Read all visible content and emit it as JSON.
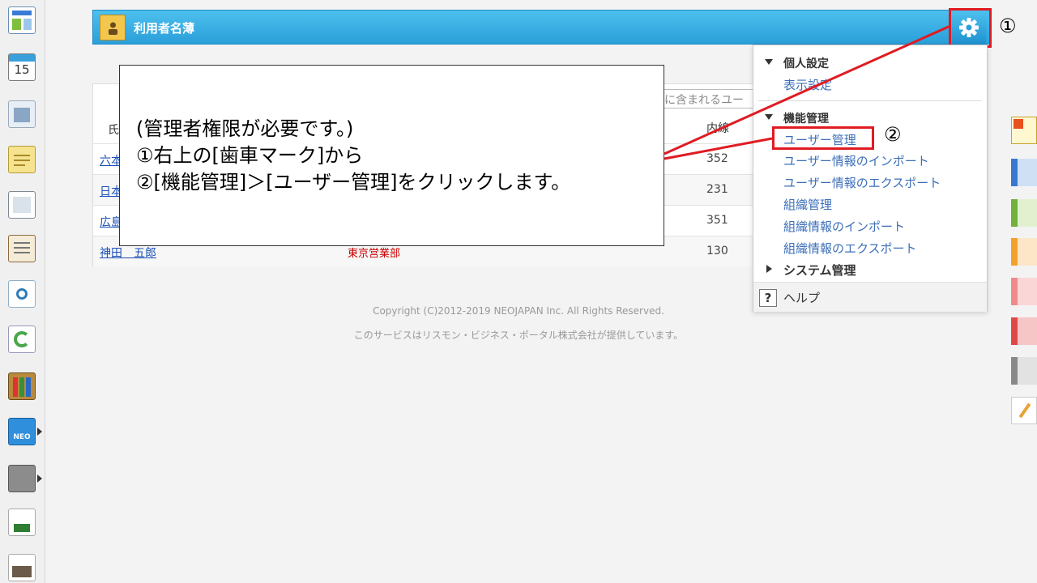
{
  "header": {
    "title": "利用者名薄"
  },
  "markers": {
    "one": "①",
    "two": "②"
  },
  "table": {
    "search_placeholder": "に含まれるユー",
    "col_ext_label": "内線",
    "col_name_stub": "氏",
    "rows": [
      {
        "name": "六本",
        "dept": "",
        "ext": "352"
      },
      {
        "name": "日本",
        "dept": "",
        "ext": "231"
      },
      {
        "name": "広島",
        "dept": "",
        "ext": "351"
      },
      {
        "name": "神田　五郎",
        "dept": "東京営業部",
        "ext": "130"
      }
    ]
  },
  "footer": {
    "copyright": "Copyright (C)2012-2019 NEOJAPAN Inc. All Rights Reserved.",
    "provider": "このサービスはリスモン・ビジネス・ポータル株式会社が提供しています。"
  },
  "note": {
    "line1": "(管理者権限が必要です。)",
    "line2": "①右上の[歯車マーク]から",
    "line3": "②[機能管理]＞[ユーザー管理]をクリックします。"
  },
  "menu": {
    "personal_section": "個人設定",
    "display_settings": "表示設定",
    "function_section": "機能管理",
    "user_management": "ユーザー管理",
    "user_import": "ユーザー情報のインポート",
    "user_export": "ユーザー情報のエクスポート",
    "org_management": "組織管理",
    "org_import": "組織情報のインポート",
    "org_export": "組織情報のエクスポート",
    "system_section": "システム管理",
    "help": "ヘルプ",
    "help_glyph": "?"
  },
  "colors": {
    "header_blue": "#2a9fd9",
    "highlight_red": "#e01b22",
    "link_blue": "#3c6fb8"
  },
  "sidebar_icons": [
    "portal-icon",
    "calendar-icon",
    "facility-icon",
    "memo-icon",
    "bulletin-icon",
    "report-icon",
    "search-icon",
    "workflow-icon",
    "cabinet-icon",
    "neo-icon",
    "folder-icon",
    "tanomail-icon",
    "banner-icon"
  ],
  "calendar_day": "15",
  "neo_label": "NEO"
}
